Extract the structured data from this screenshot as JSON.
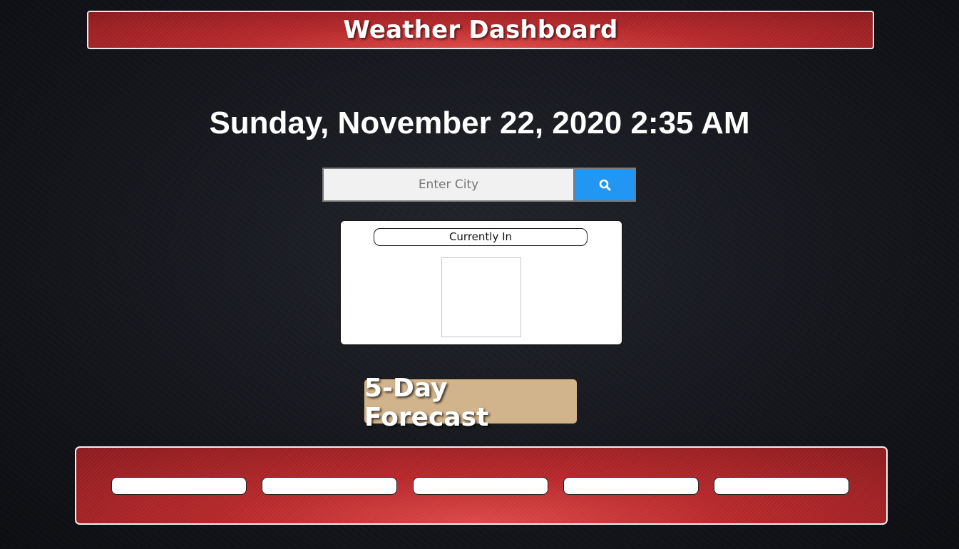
{
  "header": {
    "title": "Weather Dashboard"
  },
  "datetime": "Sunday, November 22, 2020 2:35 AM",
  "search": {
    "placeholder": "Enter City",
    "value": "",
    "button_icon": "search-icon"
  },
  "current": {
    "label": "Currently In",
    "icon": "weather-icon"
  },
  "forecast": {
    "title": "5-Day Forecast",
    "days": [
      "",
      "",
      "",
      "",
      ""
    ]
  },
  "colors": {
    "header_bg": "#b9292c",
    "search_button": "#2196f3",
    "forecast_title_bg": "#d2b48c",
    "page_bg": "#15171d"
  }
}
